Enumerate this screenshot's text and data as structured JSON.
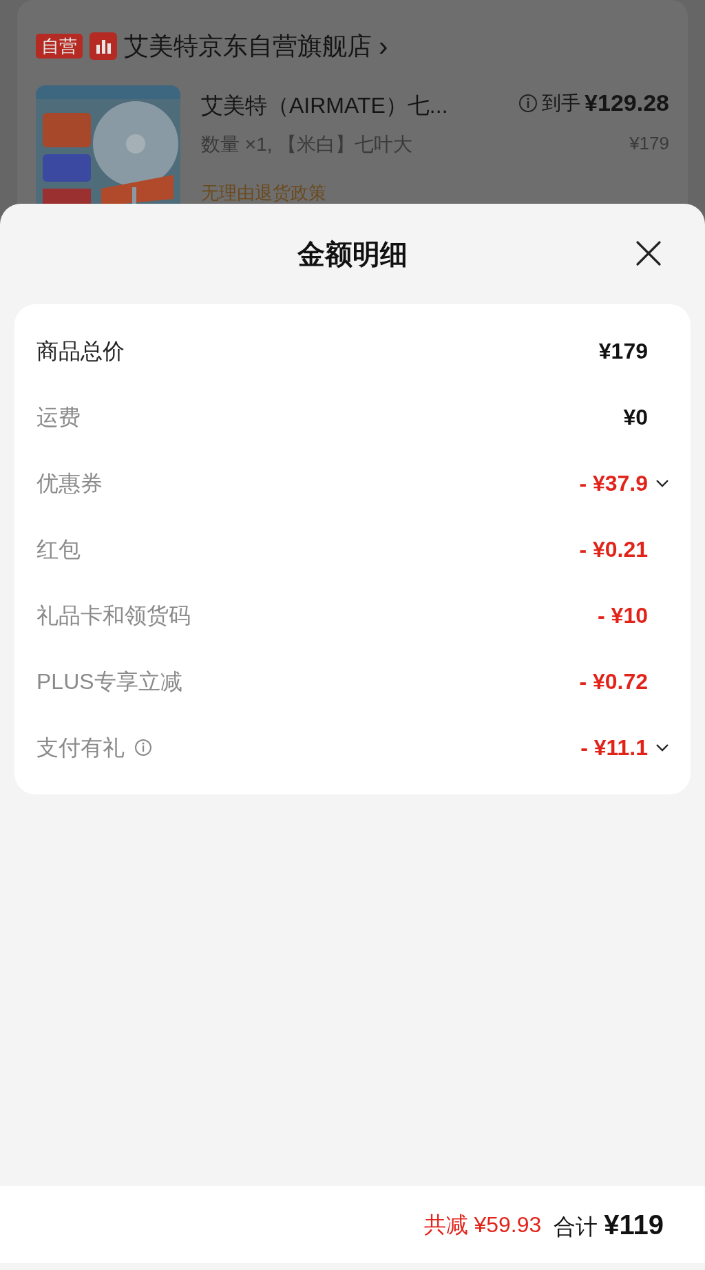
{
  "background_order": {
    "store": {
      "badge": "自营",
      "name": "艾美特京东自营旗舰店",
      "arrow": "›"
    },
    "product": {
      "title": "艾美特（AIRMATE）七...",
      "final_price_label": "到手",
      "final_price": "¥129.28",
      "spec": "数量 ×1, 【米白】七叶大",
      "original_price": "¥179",
      "policy": "无理由退货政策"
    }
  },
  "sheet": {
    "title": "金额明细",
    "rows": [
      {
        "label": "商品总价",
        "value": "¥179",
        "kind": "total",
        "expandable": false,
        "info": false
      },
      {
        "label": "运费",
        "value": "¥0",
        "kind": "normal",
        "expandable": false,
        "info": false
      },
      {
        "label": "优惠券",
        "value": "- ¥37.9",
        "kind": "discount",
        "expandable": true,
        "info": false
      },
      {
        "label": "红包",
        "value": "- ¥0.21",
        "kind": "discount",
        "expandable": false,
        "info": false
      },
      {
        "label": "礼品卡和领货码",
        "value": "- ¥10",
        "kind": "discount",
        "expandable": false,
        "info": false
      },
      {
        "label": "PLUS专享立减",
        "value": "- ¥0.72",
        "kind": "discount",
        "expandable": false,
        "info": false
      },
      {
        "label": "支付有礼",
        "value": "- ¥11.1",
        "kind": "discount",
        "expandable": true,
        "info": true
      }
    ]
  },
  "bottom_bar": {
    "saved_label": "共减",
    "saved": "¥59.93",
    "total_label": "合计",
    "total": "¥119"
  }
}
